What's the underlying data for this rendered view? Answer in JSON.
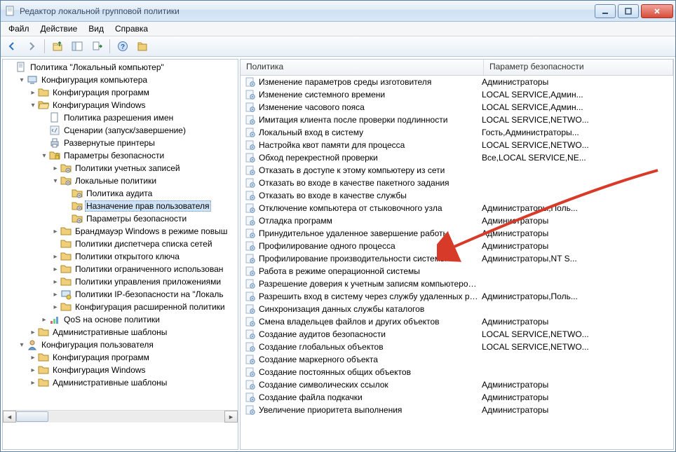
{
  "window": {
    "title": "Редактор локальной групповой политики"
  },
  "menu": {
    "file": "Файл",
    "action": "Действие",
    "view": "Вид",
    "help": "Справка"
  },
  "columns": {
    "policy": "Политика",
    "security": "Параметр безопасности"
  },
  "tree": [
    {
      "depth": 0,
      "twist": "",
      "icon": "policy-root",
      "label": "Политика \"Локальный компьютер\""
    },
    {
      "depth": 1,
      "twist": "▾",
      "icon": "computer",
      "label": "Конфигурация компьютера"
    },
    {
      "depth": 2,
      "twist": "▸",
      "icon": "folder",
      "label": "Конфигурация программ"
    },
    {
      "depth": 2,
      "twist": "▾",
      "icon": "folder-open",
      "label": "Конфигурация Windows"
    },
    {
      "depth": 3,
      "twist": "",
      "icon": "doc",
      "label": "Политика разрешения имен"
    },
    {
      "depth": 3,
      "twist": "",
      "icon": "script",
      "label": "Сценарии (запуск/завершение)"
    },
    {
      "depth": 3,
      "twist": "",
      "icon": "printer",
      "label": "Развернутые принтеры"
    },
    {
      "depth": 3,
      "twist": "▾",
      "icon": "security",
      "label": "Параметры безопасности"
    },
    {
      "depth": 4,
      "twist": "▸",
      "icon": "folder-gear",
      "label": "Политики учетных записей"
    },
    {
      "depth": 4,
      "twist": "▾",
      "icon": "folder-gear",
      "label": "Локальные политики"
    },
    {
      "depth": 5,
      "twist": "",
      "icon": "folder-gear",
      "label": "Политика аудита"
    },
    {
      "depth": 5,
      "twist": "",
      "icon": "folder-gear",
      "label": "Назначение прав пользователя",
      "selected": true
    },
    {
      "depth": 5,
      "twist": "",
      "icon": "folder-gear",
      "label": "Параметры безопасности"
    },
    {
      "depth": 4,
      "twist": "▸",
      "icon": "folder",
      "label": "Брандмауэр Windows в режиме повыш"
    },
    {
      "depth": 4,
      "twist": "",
      "icon": "folder",
      "label": "Политики диспетчера списка сетей"
    },
    {
      "depth": 4,
      "twist": "▸",
      "icon": "folder",
      "label": "Политики открытого ключа"
    },
    {
      "depth": 4,
      "twist": "▸",
      "icon": "folder",
      "label": "Политики ограниченного использован"
    },
    {
      "depth": 4,
      "twist": "▸",
      "icon": "folder",
      "label": "Политики управления приложениями"
    },
    {
      "depth": 4,
      "twist": "▸",
      "icon": "ipsec",
      "label": "Политики IP-безопасности на \"Локаль"
    },
    {
      "depth": 4,
      "twist": "▸",
      "icon": "folder",
      "label": "Конфигурация расширенной политики"
    },
    {
      "depth": 3,
      "twist": "▸",
      "icon": "qos",
      "label": "QoS на основе политики"
    },
    {
      "depth": 2,
      "twist": "▸",
      "icon": "folder",
      "label": "Административные шаблоны"
    },
    {
      "depth": 1,
      "twist": "▾",
      "icon": "user",
      "label": "Конфигурация пользователя"
    },
    {
      "depth": 2,
      "twist": "▸",
      "icon": "folder",
      "label": "Конфигурация программ"
    },
    {
      "depth": 2,
      "twist": "▸",
      "icon": "folder",
      "label": "Конфигурация Windows"
    },
    {
      "depth": 2,
      "twist": "▸",
      "icon": "folder",
      "label": "Административные шаблоны"
    }
  ],
  "rows": [
    {
      "policy": "Изменение параметров среды изготовителя",
      "setting": "Администраторы"
    },
    {
      "policy": "Изменение системного времени",
      "setting": "LOCAL SERVICE,Админ..."
    },
    {
      "policy": "Изменение часового пояса",
      "setting": "LOCAL SERVICE,Админ..."
    },
    {
      "policy": "Имитация клиента после проверки подлинности",
      "setting": "LOCAL SERVICE,NETWO..."
    },
    {
      "policy": "Локальный вход в систему",
      "setting": "Гость,Администраторы..."
    },
    {
      "policy": "Настройка квот памяти для процесса",
      "setting": "LOCAL SERVICE,NETWO..."
    },
    {
      "policy": "Обход перекрестной проверки",
      "setting": "Все,LOCAL SERVICE,NE..."
    },
    {
      "policy": "Отказать в доступе к этому компьютеру из сети",
      "setting": ""
    },
    {
      "policy": "Отказать во входе в качестве пакетного задания",
      "setting": ""
    },
    {
      "policy": "Отказать во входе в качестве службы",
      "setting": ""
    },
    {
      "policy": "Отключение компьютера от стыковочного узла",
      "setting": "Администраторы,Поль..."
    },
    {
      "policy": "Отладка программ",
      "setting": "Администраторы"
    },
    {
      "policy": "Принудительное удаленное завершение работы",
      "setting": "Администраторы"
    },
    {
      "policy": "Профилирование одного процесса",
      "setting": "Администраторы"
    },
    {
      "policy": "Профилирование производительности системы",
      "setting": "Администраторы,NT S..."
    },
    {
      "policy": "Работа в режиме операционной системы",
      "setting": ""
    },
    {
      "policy": "Разрешение доверия к учетным записям компьютеров и...",
      "setting": ""
    },
    {
      "policy": "Разрешить вход в систему через службу удаленных рабо...",
      "setting": "Администраторы,Поль..."
    },
    {
      "policy": "Синхронизация данных службы каталогов",
      "setting": ""
    },
    {
      "policy": "Смена владельцев файлов и других объектов",
      "setting": "Администраторы"
    },
    {
      "policy": "Создание аудитов безопасности",
      "setting": "LOCAL SERVICE,NETWO..."
    },
    {
      "policy": "Создание глобальных объектов",
      "setting": "LOCAL SERVICE,NETWO..."
    },
    {
      "policy": "Создание маркерного объекта",
      "setting": ""
    },
    {
      "policy": "Создание постоянных общих объектов",
      "setting": ""
    },
    {
      "policy": "Создание символических ссылок",
      "setting": "Администраторы"
    },
    {
      "policy": "Создание файла подкачки",
      "setting": "Администраторы"
    },
    {
      "policy": "Увеличение приоритета выполнения",
      "setting": "Администраторы"
    }
  ]
}
